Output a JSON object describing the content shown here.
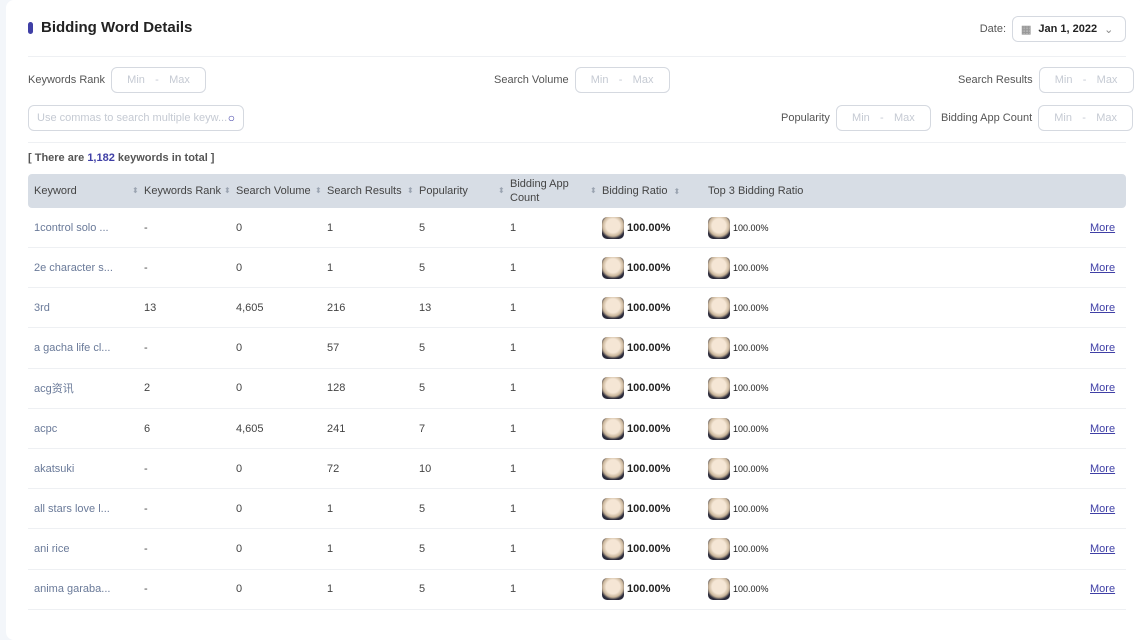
{
  "title": "Bidding Word Details",
  "date": {
    "label": "Date:",
    "value": "Jan 1, 2022"
  },
  "filters": {
    "min": "Min",
    "sep": "-",
    "max": "Max",
    "keywords_rank": "Keywords Rank",
    "search_volume": "Search Volume",
    "search_results": "Search Results",
    "popularity": "Popularity",
    "bidding_app_count": "Bidding App Count"
  },
  "search": {
    "placeholder": "Use commas to search multiple keyw..."
  },
  "total": {
    "prefix": "[ There are ",
    "count": "1,182",
    "suffix": " keywords in total ]"
  },
  "columns": [
    "Keyword",
    "Keywords Rank",
    "Search Volume",
    "Search Results",
    "Popularity",
    "Bidding App Count",
    "Bidding Ratio",
    "Top 3 Bidding Ratio"
  ],
  "more_label": "More",
  "rows": [
    [
      "1control solo ...",
      "-",
      "0",
      "1",
      "5",
      "1",
      "100.00%",
      "100.00%"
    ],
    [
      "2e character s...",
      "-",
      "0",
      "1",
      "5",
      "1",
      "100.00%",
      "100.00%"
    ],
    [
      "3rd",
      "13",
      "4,605",
      "216",
      "13",
      "1",
      "100.00%",
      "100.00%"
    ],
    [
      "a gacha life cl...",
      "-",
      "0",
      "57",
      "5",
      "1",
      "100.00%",
      "100.00%"
    ],
    [
      "acg资讯",
      "2",
      "0",
      "128",
      "5",
      "1",
      "100.00%",
      "100.00%"
    ],
    [
      "acpc",
      "6",
      "4,605",
      "241",
      "7",
      "1",
      "100.00%",
      "100.00%"
    ],
    [
      "akatsuki",
      "-",
      "0",
      "72",
      "10",
      "1",
      "100.00%",
      "100.00%"
    ],
    [
      "all stars love l...",
      "-",
      "0",
      "1",
      "5",
      "1",
      "100.00%",
      "100.00%"
    ],
    [
      "ani rice",
      "-",
      "0",
      "1",
      "5",
      "1",
      "100.00%",
      "100.00%"
    ],
    [
      "anima garaba...",
      "-",
      "0",
      "1",
      "5",
      "1",
      "100.00%",
      "100.00%"
    ]
  ]
}
